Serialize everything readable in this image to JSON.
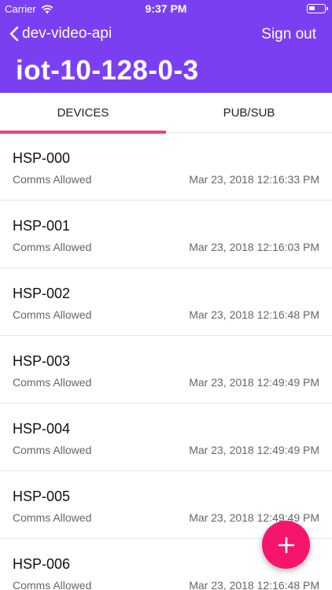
{
  "status_bar": {
    "carrier": "Carrier",
    "time": "9:37 PM"
  },
  "nav": {
    "back_label": "dev-video-api",
    "sign_out": "Sign out"
  },
  "page": {
    "title": "iot-10-128-0-3"
  },
  "tabs": [
    {
      "label": "DEVICES",
      "active": true
    },
    {
      "label": "PUB/SUB",
      "active": false
    }
  ],
  "devices": [
    {
      "name": "HSP-000",
      "status": "Comms Allowed",
      "date": "Mar 23, 2018 12:16:33 PM"
    },
    {
      "name": "HSP-001",
      "status": "Comms Allowed",
      "date": "Mar 23, 2018 12:16:03 PM"
    },
    {
      "name": "HSP-002",
      "status": "Comms Allowed",
      "date": "Mar 23, 2018 12:16:48 PM"
    },
    {
      "name": "HSP-003",
      "status": "Comms Allowed",
      "date": "Mar 23, 2018 12:49:49 PM"
    },
    {
      "name": "HSP-004",
      "status": "Comms Allowed",
      "date": "Mar 23, 2018 12:49:49 PM"
    },
    {
      "name": "HSP-005",
      "status": "Comms Allowed",
      "date": "Mar 23, 2018 12:49:49 PM"
    },
    {
      "name": "HSP-006",
      "status": "Comms Allowed",
      "date": "Mar 23, 2018 12:16:48 PM"
    }
  ],
  "fab": {
    "icon": "plus-icon"
  },
  "colors": {
    "header": "#7b3ff2",
    "tab_indicator": "#e84580",
    "fab": "#f5156e"
  }
}
